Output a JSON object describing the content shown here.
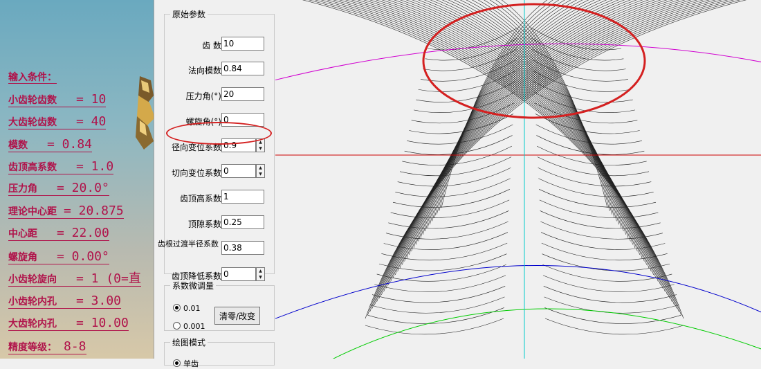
{
  "input_conditions": {
    "heading": "输入条件：",
    "rows": [
      {
        "label": "小齿轮齿数",
        "value": "=  10"
      },
      {
        "label": "大齿轮齿数",
        "value": "=  40"
      },
      {
        "label": "模数",
        "value": "=  0.84"
      },
      {
        "label": "齿顶高系数",
        "value": "=  1.0"
      },
      {
        "label": "压力角",
        "value": "=  20.0°"
      },
      {
        "label": "理论中心距",
        "value": "=  20.875"
      },
      {
        "label": "中心距",
        "value": "=  22.00"
      },
      {
        "label": "螺旋角",
        "value": "=  0.00°"
      },
      {
        "label": "小齿轮旋向",
        "value": "=  1   (0=直"
      },
      {
        "label": "小齿轮内孔",
        "value": "=  3.00"
      },
      {
        "label": "大齿轮内孔",
        "value": "=  10.00"
      },
      {
        "label": "精度等级：",
        "value": "8-8"
      }
    ]
  },
  "params": {
    "group_title": "原始参数",
    "fields": [
      {
        "label": "齿  数",
        "value": "10"
      },
      {
        "label": "法向模数",
        "value": "0.84"
      },
      {
        "label": "压力角(°)",
        "value": "20"
      },
      {
        "label": "螺旋角(°)",
        "value": "0"
      },
      {
        "label": "径向变位系数",
        "value": "0.9"
      },
      {
        "label": "切向变位系数",
        "value": "0"
      },
      {
        "label": "齿顶高系数",
        "value": "1"
      },
      {
        "label": "顶隙系数",
        "value": "0.25"
      },
      {
        "label": "齿根过渡半径系数",
        "value": "0.38"
      },
      {
        "label": "齿顶降低系数",
        "value": "0"
      }
    ]
  },
  "fine_adjust": {
    "title": "系数微调量",
    "option1": "0.01",
    "option2": "0.001",
    "selected": "0.01",
    "button": "清零/改变"
  },
  "draw_mode": {
    "title": "绘图模式",
    "option1": "单齿"
  },
  "colors": {
    "highlight": "#d42020",
    "input_text": "#b0124a",
    "tip_circle": "#d000d0",
    "pitch_circle": "#0000cc",
    "root_circle": "#00cc00",
    "center_line": "#00cccc",
    "horizontal_line": "#cc0000"
  }
}
